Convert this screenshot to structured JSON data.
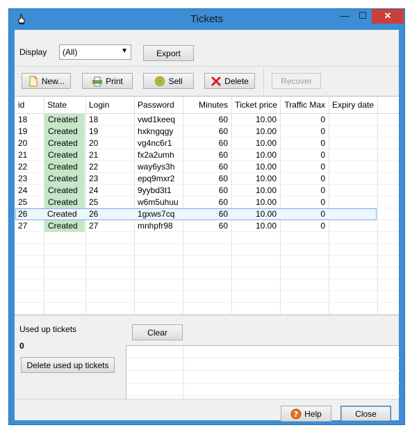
{
  "window": {
    "title": "Tickets"
  },
  "titlebar": {
    "minimize": "—",
    "maximize": "☐",
    "close": "✕"
  },
  "display": {
    "label": "Display",
    "selected": "(All)"
  },
  "export_label": "Export",
  "toolbar": {
    "new": "New...",
    "print": "Print",
    "sell": "Sell",
    "delete": "Delete",
    "recover": "Recover"
  },
  "table": {
    "columns": [
      "id",
      "State",
      "Login",
      "Password",
      "Minutes",
      "Ticket price",
      "Traffic Max",
      "Expiry date"
    ],
    "rows": [
      [
        "18",
        "Created",
        "18",
        "vwd1keeq",
        "60",
        "10.00",
        "0",
        ""
      ],
      [
        "19",
        "Created",
        "19",
        "hxkngqgy",
        "60",
        "10.00",
        "0",
        ""
      ],
      [
        "20",
        "Created",
        "20",
        "vg4nc6r1",
        "60",
        "10.00",
        "0",
        ""
      ],
      [
        "21",
        "Created",
        "21",
        "fx2a2umh",
        "60",
        "10.00",
        "0",
        ""
      ],
      [
        "22",
        "Created",
        "22",
        "way6ys3h",
        "60",
        "10.00",
        "0",
        ""
      ],
      [
        "23",
        "Created",
        "23",
        "epq9mxr2",
        "60",
        "10.00",
        "0",
        ""
      ],
      [
        "24",
        "Created",
        "24",
        "9yybd3t1",
        "60",
        "10.00",
        "0",
        ""
      ],
      [
        "25",
        "Created",
        "25",
        "w6m5uhuu",
        "60",
        "10.00",
        "0",
        ""
      ],
      [
        "26",
        "Created",
        "26",
        "1gxws7cq",
        "60",
        "10.00",
        "0",
        ""
      ],
      [
        "27",
        "Created",
        "27",
        "mnhpfr98",
        "60",
        "10.00",
        "0",
        ""
      ]
    ],
    "selected_row_index": 8
  },
  "used_up": {
    "label": "Used up tickets",
    "count": "0",
    "delete_button": "Delete used up tickets"
  },
  "clear_label": "Clear",
  "footer": {
    "help": "Help",
    "close": "Close"
  },
  "colors": {
    "created_state": "#c6e6c8",
    "selection": "#7db0e3",
    "frame": "#3c8dd6",
    "close_red": "#c7403a"
  }
}
